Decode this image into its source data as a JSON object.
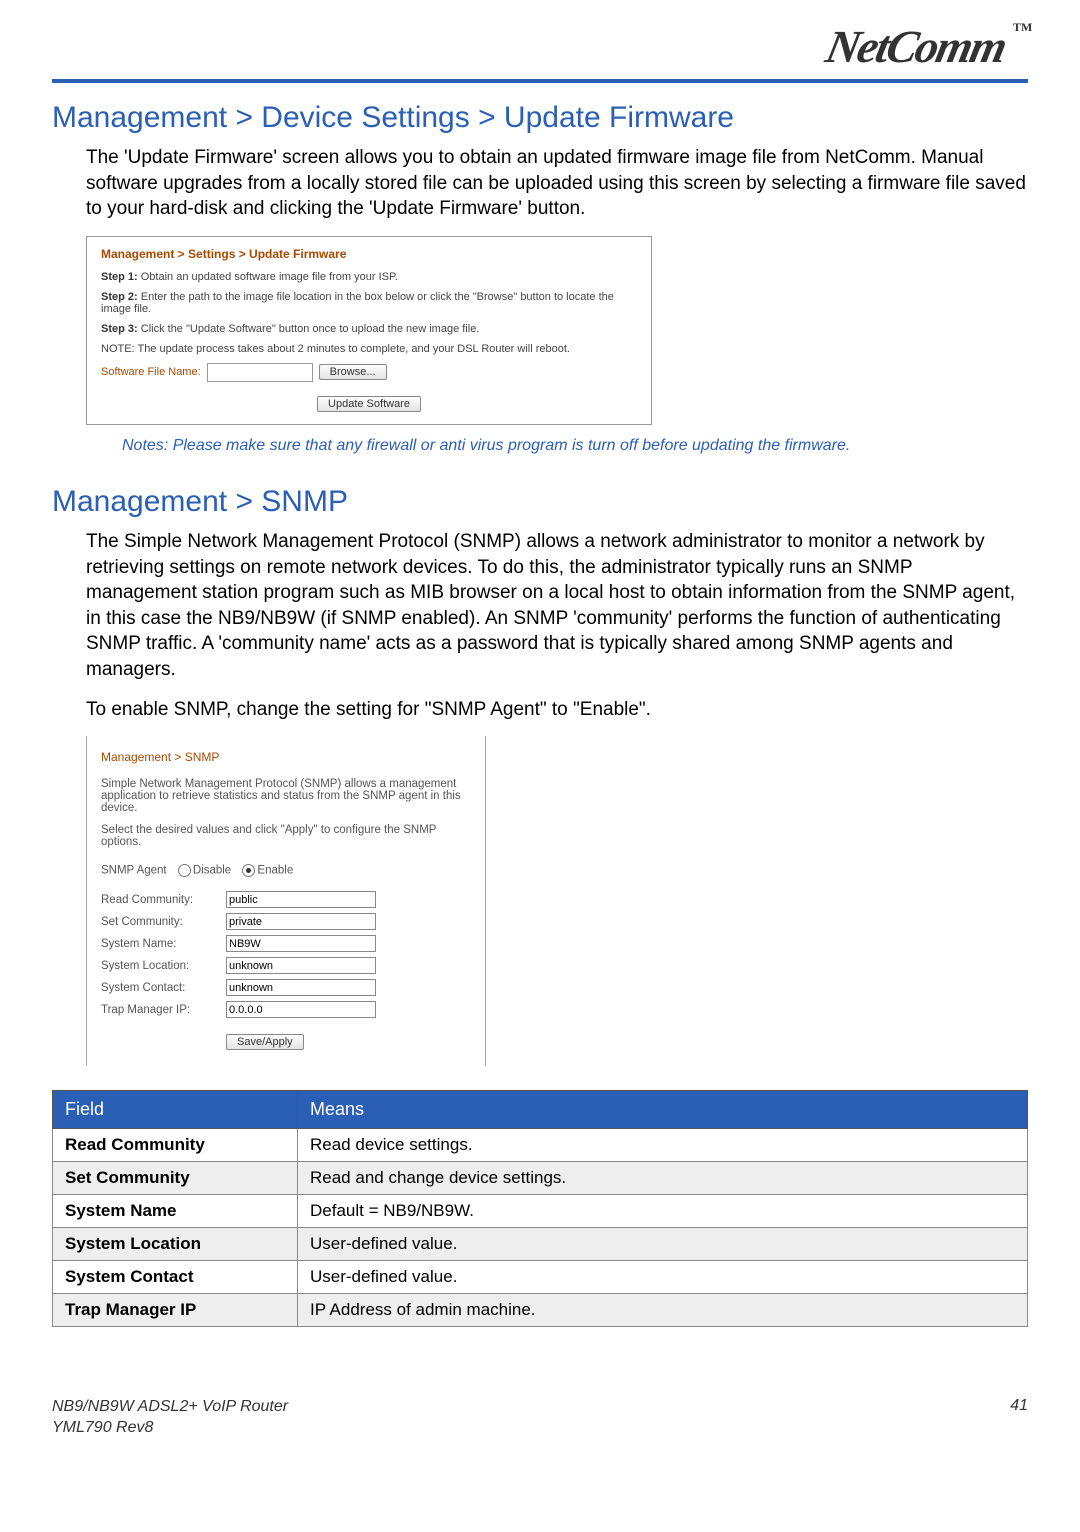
{
  "brand": "NetComm",
  "tm": "TM",
  "section1": {
    "title": "Management > Device Settings > Update Firmware",
    "para": "The 'Update Firmware' screen allows you to obtain an updated firmware image file from NetComm. Manual software upgrades from a locally stored file can be uploaded using this screen by selecting a  firmware file saved to your hard-disk and clicking the 'Update Firmware' button."
  },
  "shot1": {
    "crumb": "Management > Settings > Update Firmware",
    "step1_b": "Step 1:",
    "step1": " Obtain an updated software image file from your ISP.",
    "step2_b": "Step 2:",
    "step2": " Enter the path to the image file location in the box below or click the \"Browse\" button to locate the image file.",
    "step3_b": "Step 3:",
    "step3": " Click the \"Update Software\" button once to upload the new image file.",
    "note": "NOTE: The update process takes about 2 minutes to complete, and your DSL Router will reboot.",
    "file_label": "Software File Name:",
    "browse": "Browse...",
    "update": "Update Software"
  },
  "note_line": "Notes: Please make sure that any firewall or anti virus program is turn off before updating the firmware.",
  "section2": {
    "title": "Management > SNMP",
    "para1": "The Simple Network Management Protocol (SNMP) allows a network administrator to monitor a network by retrieving settings on remote network devices.  To do this, the administrator typically runs an SNMP management station program such as MIB browser on a local host to obtain information from the SNMP agent, in this case the NB9/NB9W (if SNMP enabled). An SNMP 'community' performs the function of authenticating SNMP traffic. A 'community name' acts as a password that is typically shared among  SNMP agents and managers.",
    "para2": "To enable SNMP, change the setting for \"SNMP Agent\" to \"Enable\"."
  },
  "shot2": {
    "crumb": "Management > SNMP",
    "p1": "Simple Network Management Protocol (SNMP) allows a management application to retrieve statistics and status from the SNMP agent in this device.",
    "p2": "Select the desired values and click \"Apply\" to configure the SNMP options.",
    "agent_label": "SNMP Agent",
    "opt_disable": "Disable",
    "opt_enable": "Enable",
    "fields": {
      "read_l": "Read Community:",
      "read_v": "public",
      "set_l": "Set Community:",
      "set_v": "private",
      "name_l": "System Name:",
      "name_v": "NB9W",
      "loc_l": "System Location:",
      "loc_v": "unknown",
      "con_l": "System Contact:",
      "con_v": "unknown",
      "trap_l": "Trap Manager IP:",
      "trap_v": "0.0.0.0"
    },
    "save": "Save/Apply"
  },
  "table": {
    "h1": "Field",
    "h2": "Means",
    "rows": [
      {
        "f": "Read Community",
        "m": "Read device settings."
      },
      {
        "f": "Set Community",
        "m": "Read and change device settings."
      },
      {
        "f": "System Name",
        "m": "Default = NB9/NB9W."
      },
      {
        "f": "System Location",
        "m": "User-defined value."
      },
      {
        "f": "System Contact",
        "m": "User-defined value."
      },
      {
        "f": "Trap Manager IP",
        "m": "IP Address of admin machine."
      }
    ]
  },
  "footer": {
    "l1": "NB9/NB9W ADSL2+ VoIP Router",
    "l2": "YML790 Rev8",
    "page": "41"
  }
}
